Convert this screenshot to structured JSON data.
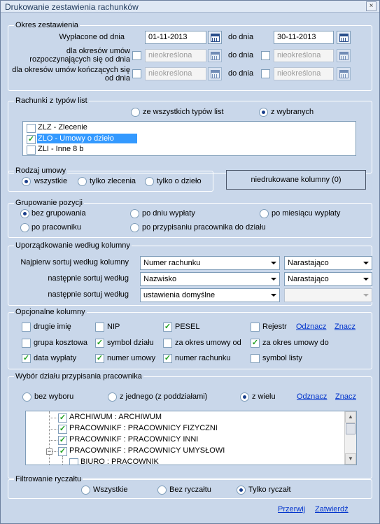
{
  "window": {
    "title": "Drukowanie zestawienia rachunków",
    "close_glyph": "×"
  },
  "okres": {
    "legend": "Okres zestawienia",
    "row1": {
      "label": "Wypłacone od dnia",
      "from": "01-11-2013",
      "to_label": "do dnia",
      "to": "30-11-2013"
    },
    "row2": {
      "label": "dla okresów umów rozpoczynających się od dnia",
      "from": "nieokreślona",
      "to_label": "do dnia",
      "to": "nieokreślona"
    },
    "row3": {
      "label": "dla okresów umów kończących się od dnia",
      "from": "nieokreślona",
      "to_label": "do dnia",
      "to": "nieokreślona"
    }
  },
  "typy": {
    "legend": "Rachunki z typów list",
    "opt_all": "ze wszystkich typów list",
    "opt_selected": "z wybranych",
    "items": [
      {
        "label": "ZLZ - Zlecenie",
        "checked": false
      },
      {
        "label": "ZLO - Umowy o dzieło",
        "checked": true
      },
      {
        "label": "ZLI - Inne 8 b",
        "checked": false
      }
    ]
  },
  "rodzaj": {
    "legend": "Rodzaj umowy",
    "options": [
      "wszystkie",
      "tylko zlecenia",
      "tylko o dzieło"
    ],
    "selected": 0
  },
  "niedrukowane": {
    "label": "niedrukowane kolumny (0)"
  },
  "grupowanie": {
    "legend": "Grupowanie pozycji",
    "options": [
      "bez grupowania",
      "po dniu wypłaty",
      "po miesiącu wypłaty",
      "po pracowniku",
      "po przypisaniu pracownika do działu"
    ],
    "selected": 0
  },
  "sort": {
    "legend": "Uporządkowanie według kolumny",
    "rows": [
      {
        "label": "Najpierw sortuj według kolumny",
        "column": "Numer rachunku",
        "order": "Narastająco"
      },
      {
        "label": "następnie sortuj według",
        "column": "Nazwisko",
        "order": "Narastająco"
      },
      {
        "label": "następnie sortuj według",
        "column": "ustawienia domyślne",
        "order": ""
      }
    ]
  },
  "kolumny": {
    "legend": "Opcjonalne kolumny",
    "items": [
      {
        "label": "drugie imię",
        "checked": false
      },
      {
        "label": "NIP",
        "checked": false
      },
      {
        "label": "PESEL",
        "checked": true
      },
      {
        "label": "Rejestr",
        "checked": false
      },
      {
        "label": "grupa kosztowa",
        "checked": false
      },
      {
        "label": "symbol działu",
        "checked": true
      },
      {
        "label": "za okres umowy od",
        "checked": false
      },
      {
        "label": "za okres umowy do",
        "checked": true
      },
      {
        "label": "data wypłaty",
        "checked": true
      },
      {
        "label": "numer umowy",
        "checked": true
      },
      {
        "label": "numer rachunku",
        "checked": true
      },
      {
        "label": "symbol listy",
        "checked": false
      }
    ],
    "odznacz": "Odznacz",
    "zaznacz": "Znacz"
  },
  "dzial": {
    "legend": "Wybór działu przypisania pracownika",
    "options": [
      "bez wyboru",
      "z jednego (z poddziałami)",
      "z wielu"
    ],
    "selected": 2,
    "odznacz": "Odznacz",
    "zaznacz": "Znacz",
    "tree": [
      {
        "label": "ARCHIWUM : ARCHIWUM",
        "checked": true
      },
      {
        "label": "PRACOWNIKF : PRACOWNICY FIZYCZNI",
        "checked": true
      },
      {
        "label": "PRACOWNIKF : PRACOWNICY INNI",
        "checked": true
      },
      {
        "label": "PRACOWNIKF : PRACOWNICY UMYSŁOWI",
        "checked": true
      },
      {
        "label": "BIURO : PRACOWNIK",
        "checked": false
      }
    ]
  },
  "ryczalt": {
    "legend": "Filtrowanie ryczałtu",
    "options": [
      "Wszystkie",
      "Bez ryczałtu",
      "Tylko ryczałt"
    ],
    "selected": 2
  },
  "footer": {
    "przerwij": "Przerwij",
    "zatwierdz": "Zatwierdź"
  },
  "colors": {
    "background": "#c9d7ea",
    "link": "#0033cc",
    "selection": "#3399ff",
    "check": "#21a121"
  },
  "icons": {
    "calendar": "calendar-icon",
    "dropdown": "chevron-down-icon",
    "tree": "expander-icon"
  }
}
